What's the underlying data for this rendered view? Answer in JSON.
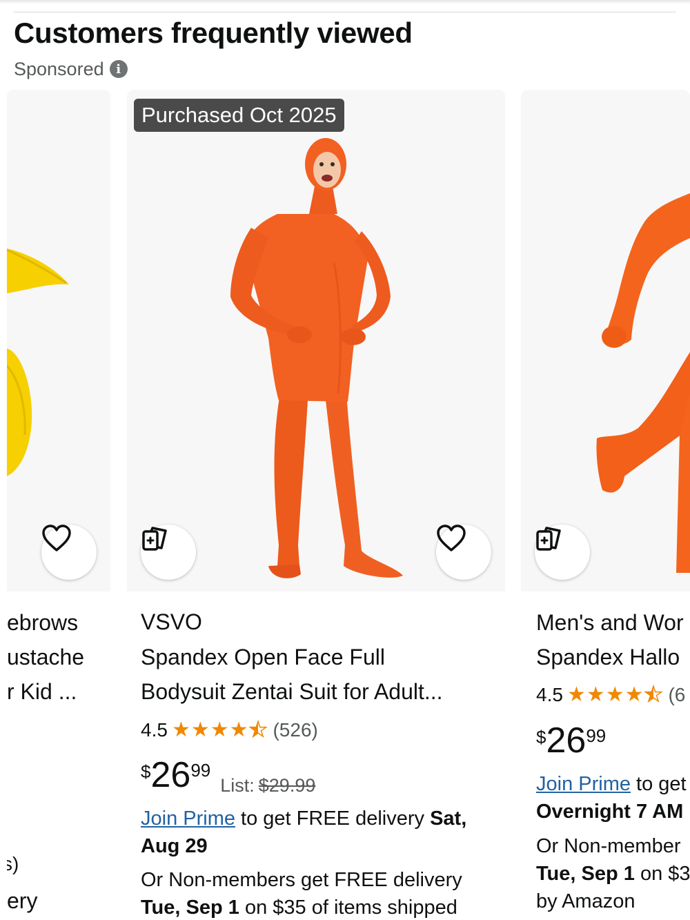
{
  "section": {
    "title": "Customers frequently viewed",
    "sponsored_label": "Sponsored",
    "info_icon": "info-icon"
  },
  "cards": {
    "left": {
      "title_lines": [
        "ebrows",
        "ustache",
        "r Kid ..."
      ],
      "fragment_a": "s)",
      "fragment_b": "ery"
    },
    "middle": {
      "badge": "Purchased Oct 2025",
      "brand": "VSVO",
      "title_line1": "Spandex Open Face Full",
      "title_line2": "Bodysuit Zentai Suit for Adult...",
      "rating": 4.5,
      "rating_text": "4.5",
      "review_count": "(526)",
      "price_symbol": "$",
      "price_whole": "26",
      "price_fraction": "99",
      "list_label": "List:",
      "list_price": "$29.99",
      "join_prime": "Join Prime",
      "delivery_prefix": " to get FREE delivery ",
      "delivery_date": "Sat,",
      "delivery_date2": "Aug 29",
      "nonmember_line": "Or Non-members get FREE delivery",
      "nonmember_date": "Tue, Sep 1",
      "nonmember_suffix": " on $35 of items shipped"
    },
    "right": {
      "title_line1": "Men's and Wor",
      "title_line2": "Spandex Hallo",
      "rating_text": "4.5",
      "review_count": "(6",
      "price_symbol": "$",
      "price_whole": "26",
      "price_fraction": "99",
      "join_prime": "Join Prime",
      "delivery_prefix": " to get",
      "overnight": "Overnight 7 AM",
      "nonmember_line": "Or Non-member",
      "nonmember_date": "Tue, Sep 1",
      "nonmember_suffix": " on $3",
      "by_amazon": "by Amazon"
    }
  },
  "colors": {
    "star": "#f08804",
    "link": "#2162a1",
    "badge_bg": "#4a4a4a",
    "suit": "#f05a1e"
  },
  "icons": [
    "heart-icon",
    "compare-icon",
    "info-icon"
  ]
}
